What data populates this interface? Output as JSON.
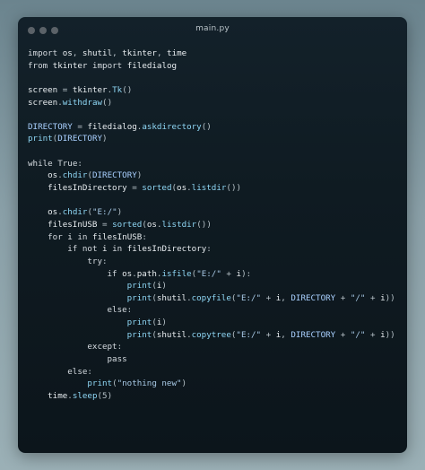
{
  "window": {
    "title": "main.py",
    "dots": [
      "close",
      "minimize",
      "maximize"
    ]
  },
  "code": {
    "lines": [
      "import os, shutil, tkinter, time",
      "from tkinter import filedialog",
      "",
      "screen = tkinter.Tk()",
      "screen.withdraw()",
      "",
      "DIRECTORY = filedialog.askdirectory()",
      "print(DIRECTORY)",
      "",
      "while True:",
      "    os.chdir(DIRECTORY)",
      "    filesInDirectory = sorted(os.listdir())",
      "",
      "    os.chdir(\"E:/\")",
      "    filesInUSB = sorted(os.listdir())",
      "    for i in filesInUSB:",
      "        if not i in filesInDirectory:",
      "            try:",
      "                if os.path.isfile(\"E:/\" + i):",
      "                    print(i)",
      "                    print(shutil.copyfile(\"E:/\" + i, DIRECTORY + \"/\" + i))",
      "                else:",
      "                    print(i)",
      "                    print(shutil.copytree(\"E:/\" + i, DIRECTORY + \"/\" + i))",
      "            except:",
      "                pass",
      "        else:",
      "            print(\"nothing new\")",
      "    time.sleep(5)"
    ]
  }
}
